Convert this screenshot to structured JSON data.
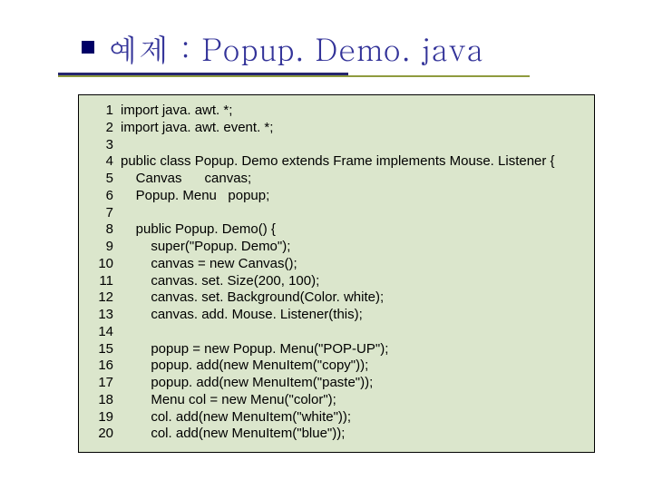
{
  "title": "예제 : Popup. Demo. java",
  "code": {
    "lines": [
      {
        "n": "1",
        "t": "import java. awt. *;"
      },
      {
        "n": "2",
        "t": "import java. awt. event. *;"
      },
      {
        "n": "3",
        "t": ""
      },
      {
        "n": "4",
        "t": "public class Popup. Demo extends Frame implements Mouse. Listener {"
      },
      {
        "n": "5",
        "t": "    Canvas      canvas;"
      },
      {
        "n": "6",
        "t": "    Popup. Menu   popup;"
      },
      {
        "n": "7",
        "t": ""
      },
      {
        "n": "8",
        "t": "    public Popup. Demo() {"
      },
      {
        "n": "9",
        "t": "        super(\"Popup. Demo\");"
      },
      {
        "n": "10",
        "t": "        canvas = new Canvas();"
      },
      {
        "n": "11",
        "t": "        canvas. set. Size(200, 100);"
      },
      {
        "n": "12",
        "t": "        canvas. set. Background(Color. white);"
      },
      {
        "n": "13",
        "t": "        canvas. add. Mouse. Listener(this);"
      },
      {
        "n": "14",
        "t": ""
      },
      {
        "n": "15",
        "t": "        popup = new Popup. Menu(\"POP-UP\");"
      },
      {
        "n": "16",
        "t": "        popup. add(new MenuItem(\"copy\"));"
      },
      {
        "n": "17",
        "t": "        popup. add(new MenuItem(\"paste\"));"
      },
      {
        "n": "18",
        "t": "        Menu col = new Menu(\"color\");"
      },
      {
        "n": "19",
        "t": "        col. add(new MenuItem(\"white\"));"
      },
      {
        "n": "20",
        "t": "        col. add(new MenuItem(\"blue\"));"
      }
    ]
  }
}
